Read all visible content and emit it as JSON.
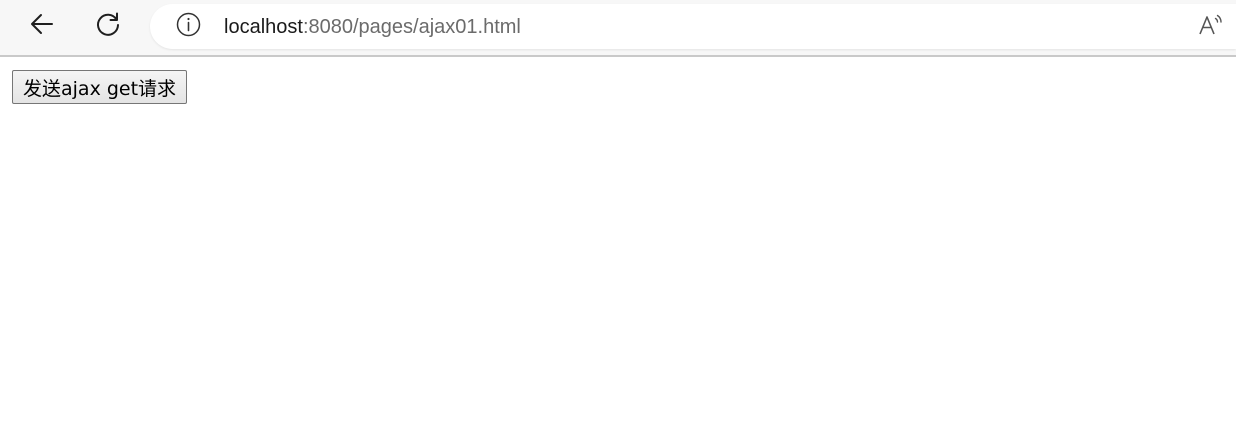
{
  "browser": {
    "url_host": "localhost",
    "url_path": ":8080/pages/ajax01.html",
    "icons": {
      "back": "back-arrow-icon",
      "reload": "reload-icon",
      "info": "info-icon",
      "read_aloud": "read-aloud-icon"
    }
  },
  "page": {
    "button_label": "发送ajax get请求"
  }
}
